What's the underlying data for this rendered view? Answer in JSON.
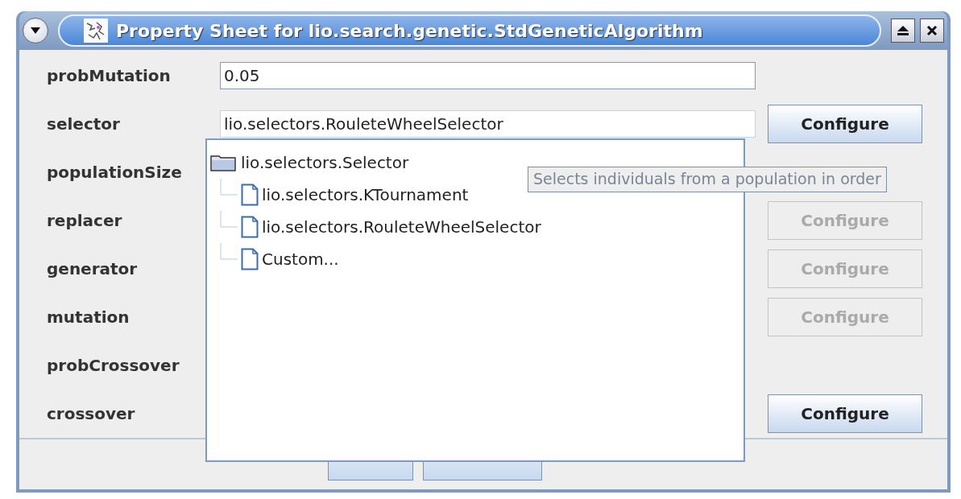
{
  "window": {
    "title": "Property Sheet for lio.search.genetic.StdGeneticAlgorithm"
  },
  "properties": [
    {
      "label": "probMutation",
      "value": "0.05"
    },
    {
      "label": "selector",
      "value": "lio.selectors.RouleteWheelSelector",
      "focused": true,
      "button": {
        "label": "Configure",
        "disabled": false
      }
    },
    {
      "label": "populationSize"
    },
    {
      "label": "replacer",
      "button": {
        "label": "Configure",
        "disabled": true
      }
    },
    {
      "label": "generator",
      "button": {
        "label": "Configure",
        "disabled": true
      }
    },
    {
      "label": "mutation",
      "button": {
        "label": "Configure",
        "disabled": true
      }
    },
    {
      "label": "probCrossover"
    },
    {
      "label": "crossover",
      "button": {
        "label": "Configure",
        "disabled": false
      }
    }
  ],
  "popup_tree": {
    "label": "lio.selectors.Selector",
    "kind": "folder",
    "children": [
      {
        "label": "lio.selectors.KTournament",
        "kind": "file"
      },
      {
        "label": "lio.selectors.RouleteWheelSelector",
        "kind": "file"
      },
      {
        "label": "Custom...",
        "kind": "file"
      }
    ]
  },
  "tooltip": "Selects individuals from a population in order"
}
